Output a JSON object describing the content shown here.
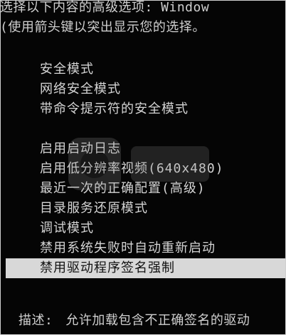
{
  "header": {
    "line1": "选择以下内容的高级选项: Window",
    "line2": "(使用箭头键以突出显示您的选择。"
  },
  "menu": {
    "items": [
      {
        "label": "安全模式"
      },
      {
        "label": "网络安全模式"
      },
      {
        "label": "带命令提示符的安全模式"
      },
      {
        "label": "启用启动日志"
      },
      {
        "label": "启用低分辨率视频(640x480)"
      },
      {
        "label": "最近一次的正确配置(高级)"
      },
      {
        "label": "目录服务还原模式"
      },
      {
        "label": "调试模式"
      },
      {
        "label": "禁用系统失败时自动重新启动"
      },
      {
        "label": "禁用驱动程序签名强制"
      }
    ],
    "selected_index": 9
  },
  "description": {
    "label": "描述:",
    "text": "允许加载包含不正确签名的驱动"
  },
  "colors": {
    "background": "#050505",
    "text": "#d4d4d4",
    "highlight": "#d8d8d8"
  }
}
